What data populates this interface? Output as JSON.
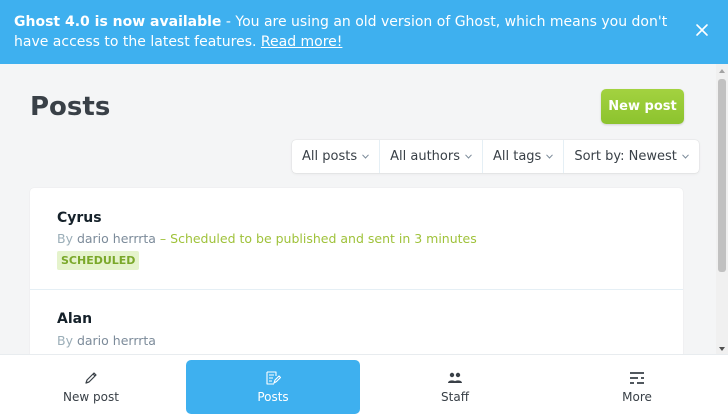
{
  "banner": {
    "strong": "Ghost 4.0 is now available",
    "text": " - You are using an old version of Ghost, which means you don't have access to the latest features. ",
    "link": "Read more!",
    "close_icon": "close-icon"
  },
  "page": {
    "title": "Posts",
    "new_post_label": "New post"
  },
  "filters": [
    {
      "label": "All posts"
    },
    {
      "label": "All authors"
    },
    {
      "label": "All tags"
    },
    {
      "label": "Sort by: Newest"
    }
  ],
  "posts": [
    {
      "title": "Cyrus",
      "by": "By ",
      "author": "dario herrrta",
      "schedule": " – Scheduled to be published and sent in 3 minutes",
      "badge": "SCHEDULED"
    },
    {
      "title": "Alan",
      "by": "By ",
      "author": "dario herrrta"
    }
  ],
  "tabbar": [
    {
      "label": "New post",
      "icon": "pencil-icon"
    },
    {
      "label": "Posts",
      "icon": "posts-icon",
      "active": true
    },
    {
      "label": "Staff",
      "icon": "staff-icon"
    },
    {
      "label": "More",
      "icon": "menu-icon"
    }
  ],
  "colors": {
    "banner": "#3eb0ef",
    "accent_green": "#9fc23a",
    "active_tab": "#3eb0ef"
  }
}
